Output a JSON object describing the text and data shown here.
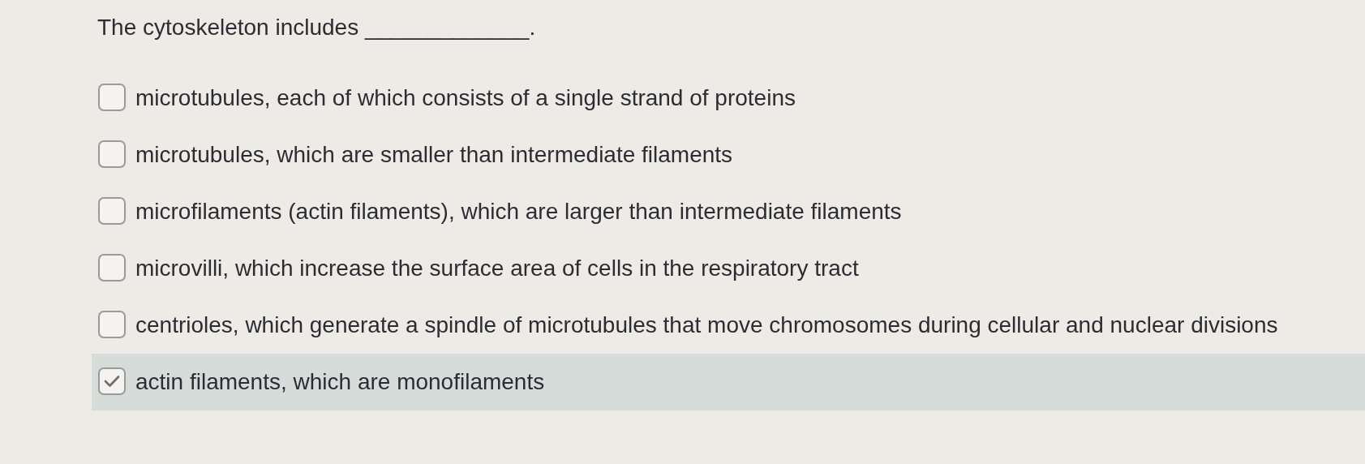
{
  "question": "The cytoskeleton includes _____________.",
  "options": [
    {
      "label": "microtubules, each of which consists of a single strand of proteins",
      "checked": false
    },
    {
      "label": "microtubules, which are smaller than intermediate filaments",
      "checked": false
    },
    {
      "label": "microfilaments (actin filaments), which are larger than intermediate filaments",
      "checked": false
    },
    {
      "label": "microvilli, which increase the surface area of cells in the respiratory tract",
      "checked": false
    },
    {
      "label": "centrioles, which generate a spindle of microtubules that move chromosomes during cellular and nuclear divisions",
      "checked": false
    },
    {
      "label": "actin filaments, which are monofilaments",
      "checked": true
    }
  ]
}
